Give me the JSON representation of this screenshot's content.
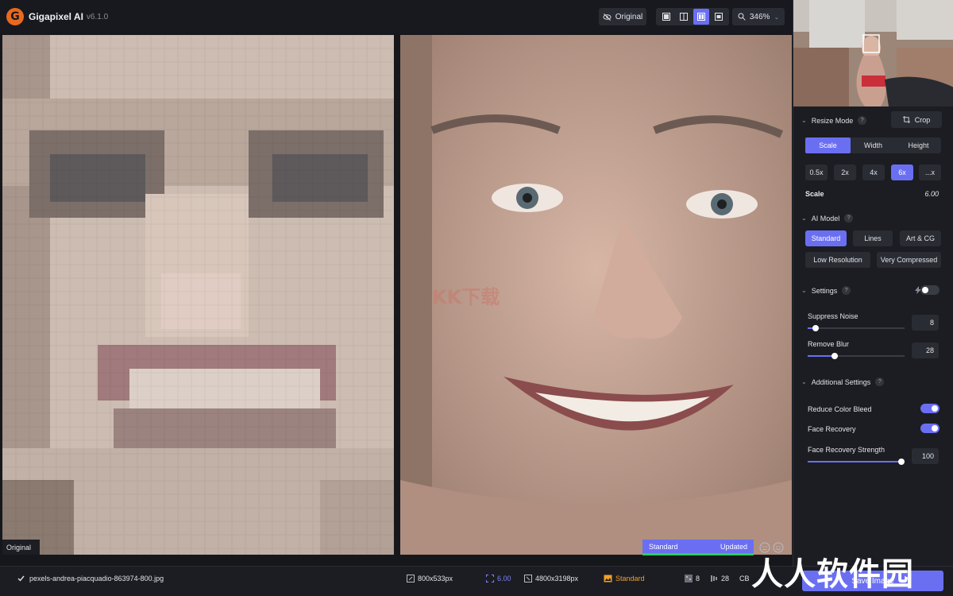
{
  "app": {
    "logo_letter": "G",
    "title": "Gigapixel AI",
    "version": "v6.1.0"
  },
  "toolbar": {
    "original_label": "Original",
    "zoom_label": "346%",
    "accent_color": "#6a6ff2"
  },
  "preview": {
    "left_label": "Original",
    "model_label": "Standard",
    "status_label": "Updated",
    "watermark_kk": "KK下载"
  },
  "sidebar": {
    "resize_mode": {
      "title": "Resize Mode",
      "help": "?",
      "crop_label": "Crop",
      "tabs": [
        "Scale",
        "Width",
        "Height"
      ],
      "active_tab": "Scale",
      "scale_chips": [
        "0.5x",
        "2x",
        "4x",
        "6x",
        "...x"
      ],
      "active_chip": "6x",
      "scale_label": "Scale",
      "scale_value": "6.00"
    },
    "ai_model": {
      "title": "AI Model",
      "help": "?",
      "models": [
        "Standard",
        "Lines",
        "Art & CG",
        "Low Resolution",
        "Very Compressed"
      ],
      "active": "Standard"
    },
    "settings": {
      "title": "Settings",
      "help": "?",
      "suppress_noise_label": "Suppress Noise",
      "suppress_noise_value": "8",
      "remove_blur_label": "Remove Blur",
      "remove_blur_value": "28"
    },
    "additional": {
      "title": "Additional Settings",
      "help": "?",
      "reduce_color_bleed_label": "Reduce Color Bleed",
      "face_recovery_label": "Face Recovery",
      "face_recovery_strength_label": "Face Recovery Strength",
      "face_recovery_strength_value": "100"
    }
  },
  "bottom": {
    "filename": "pexels-andrea-piacquadio-863974-800.jpg",
    "input_size": "800x533px",
    "scale": "6.00",
    "output_size": "4800x3198px",
    "model": "Standard",
    "noise": "8",
    "blur": "28",
    "cb_label": "CB",
    "save_label": "Save Image"
  },
  "overlay_watermark": "人人软件园"
}
